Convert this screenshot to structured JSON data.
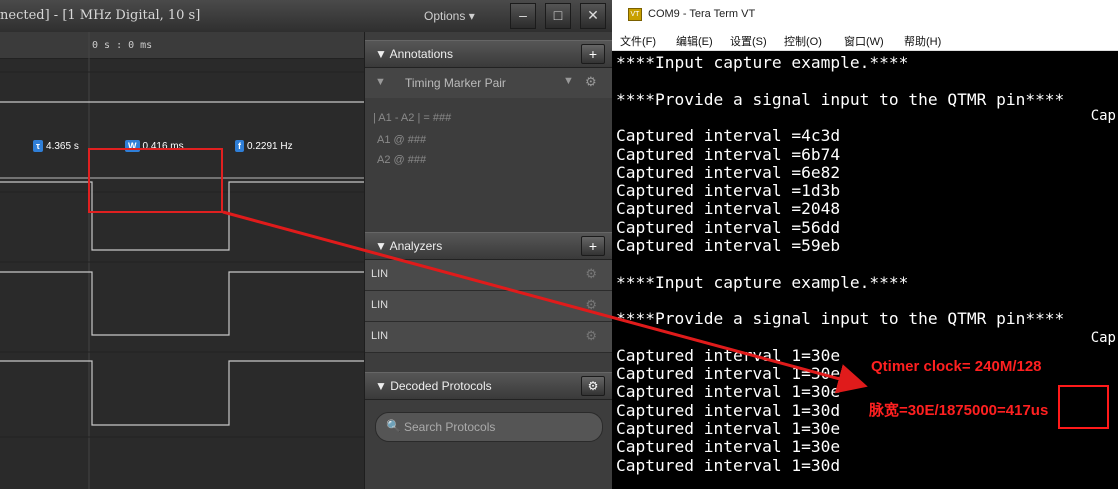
{
  "logic_analyzer": {
    "title": "nected] - [1 MHz Digital, 10 s]",
    "options_label": "Options ▾",
    "window_buttons": [
      "–",
      "□",
      "✕"
    ],
    "time_ruler": "0 s : 0 ms",
    "measurements": {
      "tau_badge": "τ",
      "tau_value": "4.365 s",
      "w_badge": "W",
      "w_value": "0.416 ms",
      "f_badge": "f",
      "f_value": "0.2291 Hz"
    },
    "annotations": {
      "header": "Annotations",
      "add": "+",
      "marker_pair": "Timing Marker Pair",
      "formula": "| A1 - A2 | = ###",
      "a1": "A1  @  ###",
      "a2": "A2  @  ###"
    },
    "analyzers": {
      "header": "Analyzers",
      "add": "+",
      "items": [
        "LIN",
        "LIN",
        "LIN"
      ]
    },
    "decoded": {
      "header": "Decoded Protocols",
      "search_placeholder": "Search Protocols"
    }
  },
  "terminal": {
    "title": "COM9 - Tera Term VT",
    "menu": [
      "文件(F)",
      "编辑(E)",
      "设置(S)",
      "控制(O)",
      "窗口(W)",
      "帮助(H)"
    ],
    "lines": [
      "****Input capture example.****",
      "",
      "****Provide a signal input to the QTMR pin****",
      "",
      "Captured interval =4c3d",
      "Captured interval =6b74",
      "Captured interval =6e82",
      "Captured interval =1d3b",
      "Captured interval =2048",
      "Captured interval =56dd",
      "Captured interval =59eb",
      "",
      "****Input capture example.****",
      "",
      "****Provide a signal input to the QTMR pin****",
      "",
      "Captured interval 1=30e",
      "Captured interval 1=30e",
      "Captured interval 1=30e",
      "Captured interval 1=30d",
      "Captured interval 1=30e",
      "Captured interval 1=30e",
      "Captured interval 1=30d"
    ],
    "edge_text": "Cap",
    "annotation_clock": "Qtimer clock= 240M/128",
    "annotation_calc": "脉宽=30E/1875000=417us"
  }
}
